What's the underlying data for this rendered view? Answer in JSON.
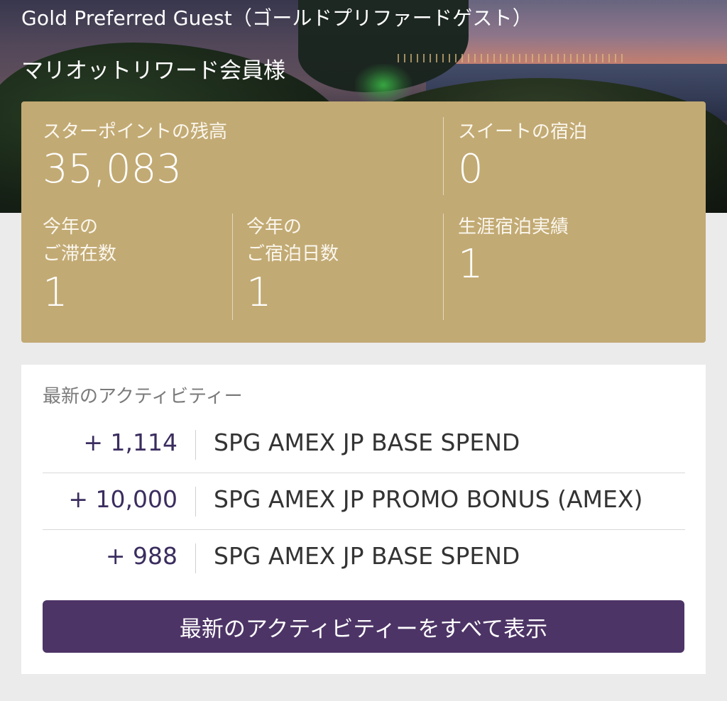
{
  "header": {
    "guest_tier": "Gold Preferred Guest（ゴールドプリファードゲスト）",
    "member_label": "マリオットリワード会員様"
  },
  "stats": {
    "star_points": {
      "label": "スターポイントの残高",
      "value": "35,083"
    },
    "suite_nights": {
      "label": "スイートの宿泊",
      "value": "0"
    },
    "stays_this_year": {
      "label_line1": "今年の",
      "label_line2": "ご滞在数",
      "value": "1"
    },
    "nights_this_year": {
      "label_line1": "今年の",
      "label_line2": "ご宿泊日数",
      "value": "1"
    },
    "lifetime_nights": {
      "label": "生涯宿泊実績",
      "value": "1"
    }
  },
  "activity": {
    "title": "最新のアクティビティー",
    "items": [
      {
        "points": "+ 1,114",
        "description": "SPG AMEX JP BASE SPEND"
      },
      {
        "points": "+ 10,000",
        "description": "SPG AMEX JP PROMO BONUS (AMEX)"
      },
      {
        "points": "+ 988",
        "description": "SPG AMEX JP BASE SPEND"
      }
    ],
    "view_all_label": "最新のアクティビティーをすべて表示"
  },
  "colors": {
    "gold_card": "#c2aa74",
    "button_purple": "#4d3466",
    "points_text": "#3b2d5f",
    "page_background": "#ebebeb"
  }
}
